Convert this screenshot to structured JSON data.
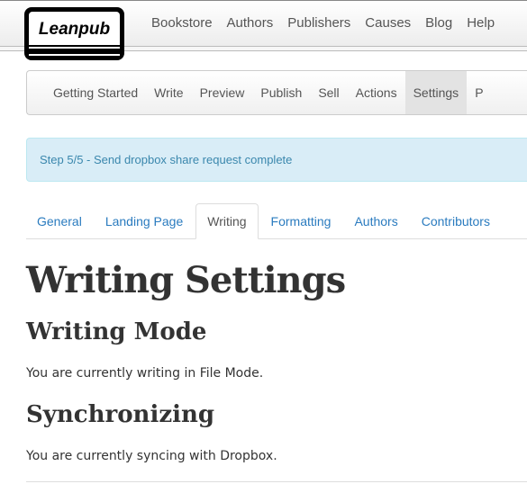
{
  "logo": {
    "text": "Leanpub"
  },
  "topnav": [
    "Bookstore",
    "Authors",
    "Publishers",
    "Causes",
    "Blog",
    "Help"
  ],
  "subnav": {
    "items": [
      "Getting Started",
      "Write",
      "Preview",
      "Publish",
      "Sell",
      "Actions",
      "Settings",
      "P"
    ],
    "active": "Settings"
  },
  "alert": "Step 5/5 - Send dropbox share request complete",
  "tabs": {
    "items": [
      "General",
      "Landing Page",
      "Writing",
      "Formatting",
      "Authors",
      "Contributors"
    ],
    "active": "Writing"
  },
  "page_title": "Writing Settings",
  "sections": [
    {
      "heading": "Writing Mode",
      "text": "You are currently writing in File Mode."
    },
    {
      "heading": "Synchronizing",
      "text": "You are currently syncing with Dropbox."
    }
  ]
}
